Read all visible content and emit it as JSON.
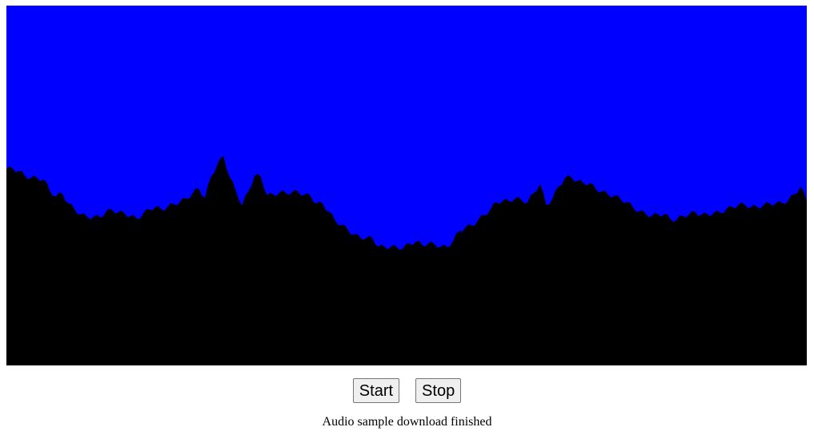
{
  "visualizer": {
    "background_color": "#0000ff",
    "waveform_color": "#000000",
    "waveform_levels": [
      0.546,
      0.547,
      0.54,
      0.526,
      0.522,
      0.52,
      0.517,
      0.485,
      0.47,
      0.478,
      0.45,
      0.433,
      0.42,
      0.413,
      0.412,
      0.413,
      0.425,
      0.433,
      0.425,
      0.423,
      0.415,
      0.408,
      0.42,
      0.434,
      0.44,
      0.433,
      0.441,
      0.448,
      0.455,
      0.463,
      0.478,
      0.492,
      0.466,
      0.525,
      0.559,
      0.581,
      0.523,
      0.484,
      0.445,
      0.484,
      0.527,
      0.524,
      0.473,
      0.475,
      0.48,
      0.48,
      0.48,
      0.483,
      0.474,
      0.471,
      0.45,
      0.449,
      0.427,
      0.402,
      0.39,
      0.378,
      0.363,
      0.356,
      0.354,
      0.353,
      0.33,
      0.329,
      0.33,
      0.327,
      0.327,
      0.338,
      0.344,
      0.335,
      0.339,
      0.337,
      0.33,
      0.329,
      0.346,
      0.373,
      0.384,
      0.388,
      0.403,
      0.418,
      0.433,
      0.454,
      0.457,
      0.457,
      0.464,
      0.46,
      0.453,
      0.479,
      0.505,
      0.446,
      0.463,
      0.497,
      0.52,
      0.524,
      0.512,
      0.507,
      0.506,
      0.49,
      0.484,
      0.474,
      0.472,
      0.461,
      0.454,
      0.439,
      0.428,
      0.422,
      0.415,
      0.42,
      0.42,
      0.407,
      0.404,
      0.416,
      0.419,
      0.426,
      0.418,
      0.42,
      0.423,
      0.425,
      0.433,
      0.44,
      0.446,
      0.447,
      0.44,
      0.44,
      0.445,
      0.45,
      0.45,
      0.452,
      0.458,
      0.475,
      0.497,
      0.457
    ]
  },
  "controls": {
    "start_label": "Start",
    "stop_label": "Stop"
  },
  "status": {
    "message": "Audio sample download finished"
  }
}
